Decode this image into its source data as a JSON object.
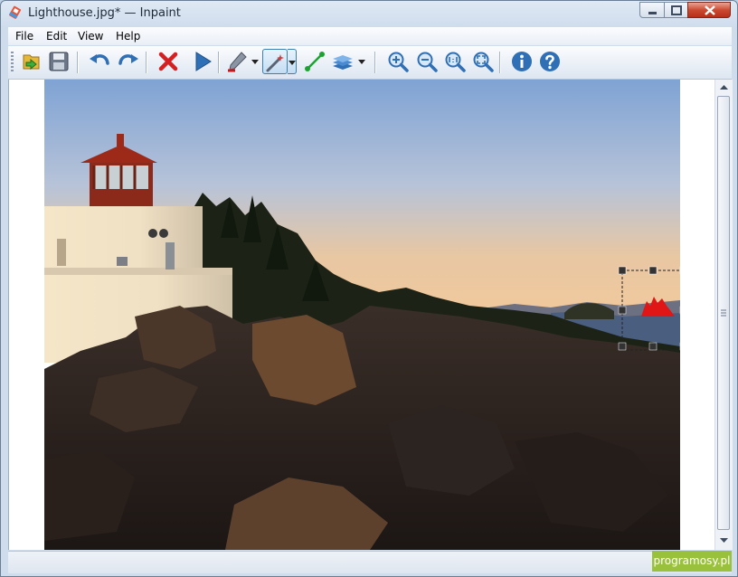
{
  "window": {
    "title": "Lighthouse.jpg* — Inpaint",
    "controls": {
      "minimize": "minimize-icon",
      "maximize": "maximize-icon",
      "close": "close-icon"
    }
  },
  "menu": {
    "items": [
      {
        "label": "File"
      },
      {
        "label": "Edit"
      },
      {
        "label": "View"
      },
      {
        "label": "Help"
      }
    ]
  },
  "toolbar": {
    "buttons": [
      "open-icon",
      "save-icon",
      "undo-icon",
      "redo-icon",
      "erase-icon",
      "run-icon",
      "marker-icon",
      "magic-wand-icon",
      "line-icon",
      "layers-icon",
      "zoom-in-icon",
      "zoom-out-icon",
      "actual-size-icon",
      "fit-icon",
      "info-icon",
      "help-icon"
    ],
    "active_tool": "magic-wand-icon",
    "colors": {
      "accent": "#2f6fb5",
      "danger": "#d42020",
      "marker": "#c81818",
      "line": "#1aa32e"
    }
  },
  "canvas": {
    "image": "lighthouse-photo",
    "selection_marker_color": "#e01515"
  },
  "watermark": {
    "text": "programosy.pl"
  }
}
